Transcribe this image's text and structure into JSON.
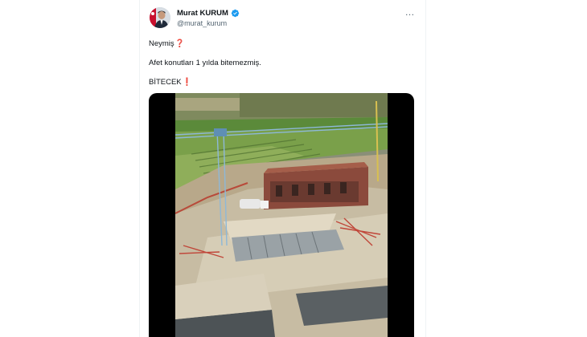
{
  "tweet": {
    "author_name": "Murat KURUM",
    "author_handle": "@murat_kurum",
    "lines": [
      {
        "text": "Neymiş",
        "emoji": "❓"
      },
      {
        "text": "Afet konutları 1 yılda bitemezmiş.",
        "emoji": ""
      },
      {
        "text": "BİTECEK",
        "emoji": "❗"
      }
    ],
    "more_icon": "…",
    "verified_icon": "verified-badge-icon",
    "media": {
      "type": "video",
      "subject": "aerial construction site"
    }
  },
  "colors": {
    "verified": "#1d9bf0",
    "text": "#0f1419",
    "secondary_text": "#536471",
    "emoji_red": "#e0245e"
  }
}
